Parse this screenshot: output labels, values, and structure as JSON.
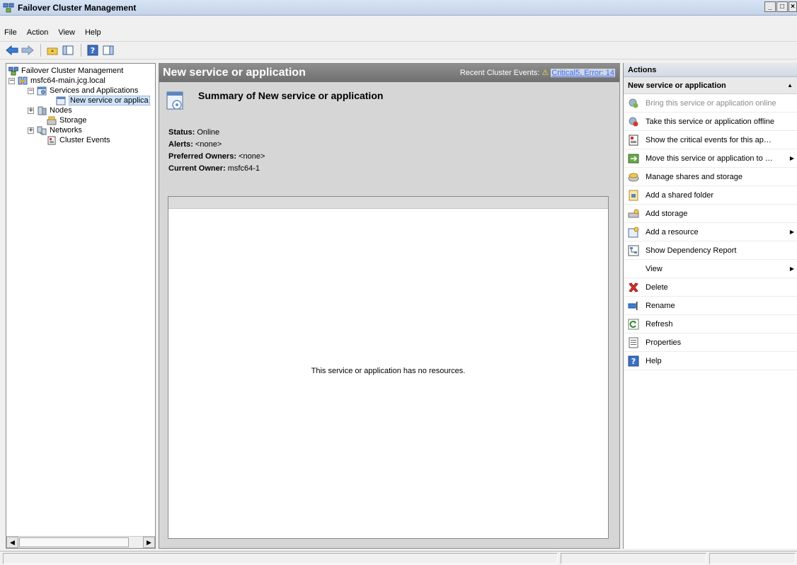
{
  "window": {
    "title": "Failover Cluster Management",
    "controls": [
      "_",
      "□",
      "×"
    ]
  },
  "menu": [
    "File",
    "Action",
    "View",
    "Help"
  ],
  "tree": {
    "items": [
      {
        "label": "Failover Cluster Management",
        "icon": "cluster-management-icon",
        "expander": ""
      },
      {
        "label": "msfc64-main.jcg.local",
        "icon": "cluster-icon",
        "expander": "⊟"
      },
      {
        "label": "Services and Applications",
        "icon": "services-icon",
        "expander": "⊟"
      },
      {
        "label": "New service or applica",
        "icon": "service-app-icon",
        "expander": ""
      },
      {
        "label": "Nodes",
        "icon": "nodes-icon",
        "expander": "+"
      },
      {
        "label": "Storage",
        "icon": "storage-icon",
        "expander": ""
      },
      {
        "label": "Networks",
        "icon": "networks-icon",
        "expander": "+"
      },
      {
        "label": "Cluster Events",
        "icon": "events-icon",
        "expander": ""
      }
    ]
  },
  "center": {
    "title": "New service or application",
    "events_label": "Recent Cluster Events:",
    "events_link": "Critical5, Error: 14",
    "summary_title": "Summary of New service or application",
    "status": [
      {
        "key": "Status",
        "value": "Online"
      },
      {
        "key": "Alerts",
        "value": "<none>"
      },
      {
        "key": "Preferred Owners",
        "value": "<none>"
      },
      {
        "key": "Current Owner",
        "value": "msfc64-1"
      }
    ],
    "empty_message": "This service or application has no resources."
  },
  "actions": {
    "header": "Actions",
    "section": "New service or application",
    "items": [
      {
        "label": "Bring this service or application online",
        "icon": "bring-online-icon",
        "disabled": true,
        "submenu": false
      },
      {
        "label": "Take this service or application offline",
        "icon": "take-offline-icon",
        "disabled": false,
        "submenu": false
      },
      {
        "label": "Show the critical events for this ap…",
        "icon": "critical-events-icon",
        "disabled": false,
        "submenu": false
      },
      {
        "label": "Move this service or application to …",
        "icon": "move-icon",
        "disabled": false,
        "submenu": true
      },
      {
        "label": "Manage shares and storage",
        "icon": "manage-shares-icon",
        "disabled": false,
        "submenu": false
      },
      {
        "label": "Add a shared folder",
        "icon": "shared-folder-icon",
        "disabled": false,
        "submenu": false
      },
      {
        "label": "Add storage",
        "icon": "add-storage-icon",
        "disabled": false,
        "submenu": false
      },
      {
        "label": "Add a resource",
        "icon": "add-resource-icon",
        "disabled": false,
        "submenu": true
      },
      {
        "label": "Show Dependency Report",
        "icon": "dependency-report-icon",
        "disabled": false,
        "submenu": false
      },
      {
        "label": "View",
        "icon": "",
        "disabled": false,
        "submenu": true
      },
      {
        "label": "Delete",
        "icon": "delete-icon",
        "disabled": false,
        "submenu": false
      },
      {
        "label": "Rename",
        "icon": "rename-icon",
        "disabled": false,
        "submenu": false
      },
      {
        "label": "Refresh",
        "icon": "refresh-icon",
        "disabled": false,
        "submenu": false
      },
      {
        "label": "Properties",
        "icon": "properties-icon",
        "disabled": false,
        "submenu": false
      },
      {
        "label": "Help",
        "icon": "help-icon",
        "disabled": false,
        "submenu": false
      }
    ]
  }
}
